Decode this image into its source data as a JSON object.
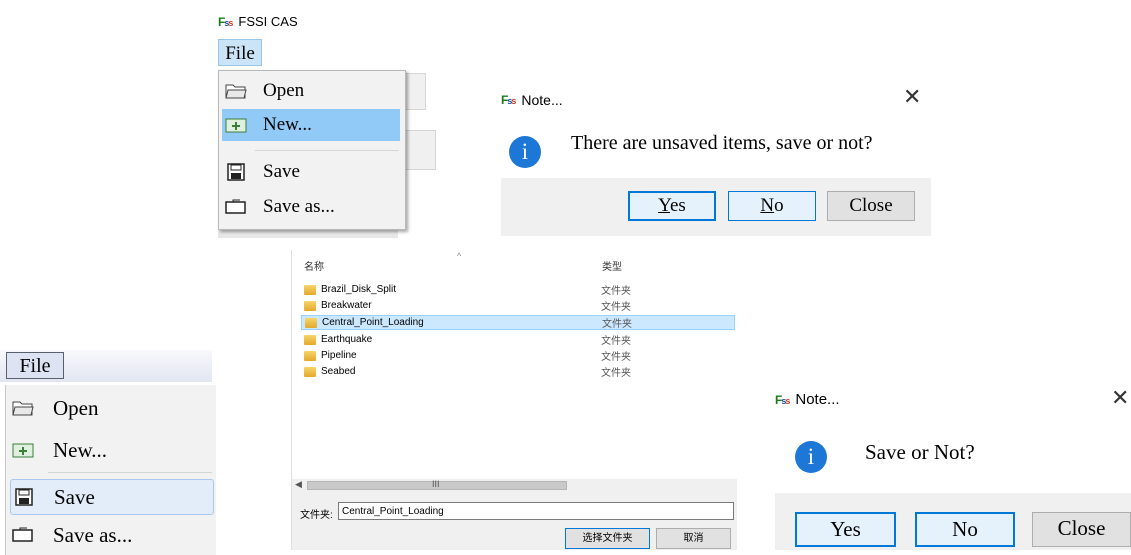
{
  "top_window": {
    "app_title": "FSSI CAS",
    "logo_text": "FSSI",
    "menu_file_label": "File",
    "menu_items": [
      {
        "label": "Open",
        "icon": "open-folder-icon"
      },
      {
        "label": "New...",
        "icon": "new-project-icon"
      },
      {
        "label": "Save",
        "icon": "save-disk-icon"
      },
      {
        "label": "Save as...",
        "icon": "save-as-icon"
      }
    ],
    "highlighted_item": "New..."
  },
  "dialog1": {
    "title": "Note...",
    "message": "There are unsaved items, save or not?",
    "info_glyph": "i",
    "buttons": {
      "yes_prefix": "Y",
      "yes_rest": "es",
      "no_prefix": "N",
      "no_rest": "o",
      "close": "Close"
    }
  },
  "bottom_menu": {
    "file_label": "File",
    "items": [
      {
        "label": "Open",
        "icon": "open-folder-icon"
      },
      {
        "label": "New...",
        "icon": "new-project-icon"
      },
      {
        "label": "Save",
        "icon": "save-disk-icon"
      },
      {
        "label": "Save as...",
        "icon": "save-as-icon"
      }
    ],
    "highlighted_item": "Save"
  },
  "folder_browser": {
    "col_name": "名称",
    "col_type": "类型",
    "sort_glyph": "^",
    "rows": [
      {
        "name": "Brazil_Disk_Split",
        "type": "文件夹"
      },
      {
        "name": "Breakwater",
        "type": "文件夹"
      },
      {
        "name": "Central_Point_Loading",
        "type": "文件夹"
      },
      {
        "name": "Earthquake",
        "type": "文件夹"
      },
      {
        "name": "Pipeline",
        "type": "文件夹"
      },
      {
        "name": "Seabed",
        "type": "文件夹"
      }
    ],
    "selected_row": "Central_Point_Loading",
    "scroll_grip": "III",
    "folder_label": "文件夹:",
    "folder_value": "Central_Point_Loading",
    "select_button": "选择文件夹",
    "cancel_button": "取消"
  },
  "dialog2": {
    "title": "Note...",
    "message": "Save or Not?",
    "info_glyph": "i",
    "buttons": {
      "yes": "Yes",
      "no": "No",
      "close": "Close"
    }
  },
  "colors": {
    "accent": "#0078d7",
    "info_blue": "#1c77d6",
    "menu_highlight": "#91c9f7",
    "list_selection": "#cce8ff"
  }
}
